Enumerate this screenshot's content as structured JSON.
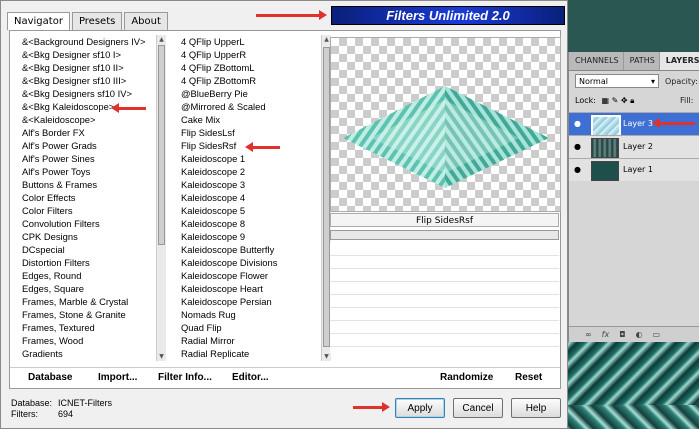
{
  "dialog": {
    "tabs": [
      "Navigator",
      "Presets",
      "About"
    ],
    "banner_title": "Filters Unlimited 2.0",
    "categories": [
      "&<Background Designers IV>",
      "&<Bkg Designer sf10 I>",
      "&<Bkg Designer sf10 II>",
      "&<Bkg Designer sf10 III>",
      "&<Bkg Designers sf10 IV>",
      "&<Bkg Kaleidoscope>",
      "&<Kaleidoscope>",
      "Alf's Border FX",
      "Alf's Power Grads",
      "Alf's Power Sines",
      "Alf's Power Toys",
      "Buttons & Frames",
      "Color Effects",
      "Color Filters",
      "Convolution Filters",
      "CPK Designs",
      "DCspecial",
      "Distortion Filters",
      "Edges, Round",
      "Edges, Square",
      "Frames, Marble & Crystal",
      "Frames, Stone & Granite",
      "Frames, Textured",
      "Frames, Wood",
      "Gradients"
    ],
    "filters": [
      "4 QFlip UpperL",
      "4 QFlip UpperR",
      "4 QFlip ZBottomL",
      "4 QFlip ZBottomR",
      "@BlueBerry Pie",
      "@Mirrored & Scaled",
      "Cake Mix",
      "Flip SidesLsf",
      "Flip SidesRsf",
      "Kaleidoscope 1",
      "Kaleidoscope 2",
      "Kaleidoscope 3",
      "Kaleidoscope 4",
      "Kaleidoscope 5",
      "Kaleidoscope 8",
      "Kaleidoscope 9",
      "Kaleidoscope Butterfly",
      "Kaleidoscope Divisions",
      "Kaleidoscope Flower",
      "Kaleidoscope Heart",
      "Kaleidoscope Persian",
      "Nomads Rug",
      "Quad Flip",
      "Radial Mirror",
      "Radial Replicate"
    ],
    "selected_filter_title": "Flip SidesRsf",
    "bottom_buttons": {
      "database": "Database",
      "import": "Import...",
      "filter_info": "Filter Info...",
      "editor": "Editor...",
      "randomize": "Randomize",
      "reset": "Reset"
    },
    "info": {
      "database_label": "Database:",
      "database_value": "ICNET-Filters",
      "filters_label": "Filters:",
      "filters_value": "694"
    },
    "actions": {
      "apply": "Apply",
      "cancel": "Cancel",
      "help": "Help"
    }
  },
  "layers_panel": {
    "tabs": [
      "CHANNELS",
      "PATHS",
      "LAYERS"
    ],
    "blend_mode": "Normal",
    "opacity_label": "Opacity:",
    "lock_label": "Lock:",
    "fill_label": "Fill:",
    "layers": [
      {
        "name": "Layer 3",
        "selected": true
      },
      {
        "name": "Layer 2",
        "selected": false
      },
      {
        "name": "Layer 1",
        "selected": false
      }
    ]
  },
  "colors": {
    "banner": "#1a3bd8",
    "selection": "#3d6fd4",
    "preview_teal": "#7fd3c4",
    "annotation_arrow": "#e0322c"
  }
}
